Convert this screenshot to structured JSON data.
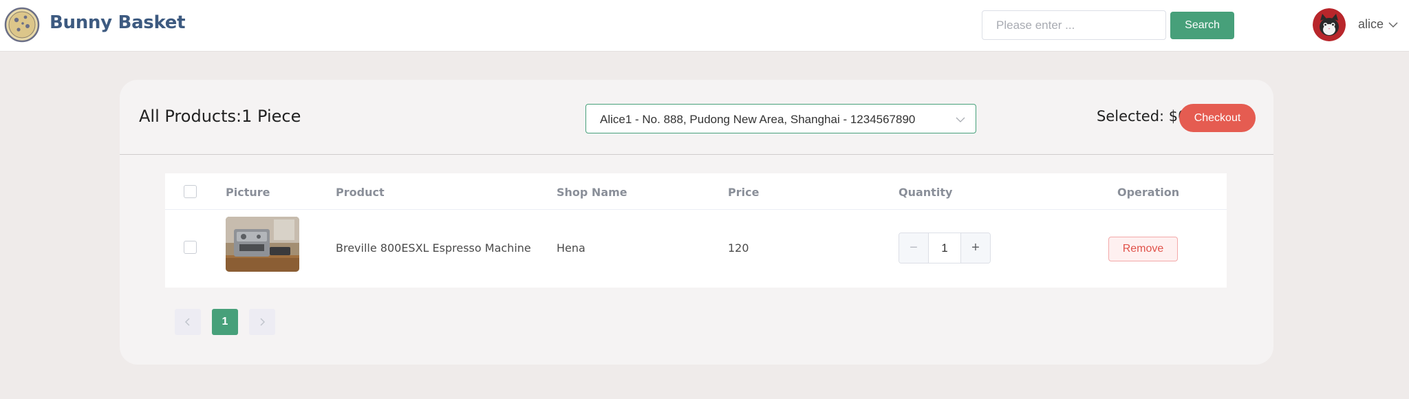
{
  "header": {
    "brand": "Bunny Basket",
    "search_placeholder": "Please enter ...",
    "search_button": "Search",
    "username": "alice"
  },
  "cart": {
    "all_products_label": "All Products:1 Piece",
    "address": "Alice1 - No. 888, Pudong New Area, Shanghai - 1234567890",
    "selected_label": "Selected: $0",
    "checkout_button": "Checkout",
    "columns": {
      "picture": "Picture",
      "product": "Product",
      "shop_name": "Shop Name",
      "price": "Price",
      "quantity": "Quantity",
      "operation": "Operation"
    },
    "rows": [
      {
        "product": "Breville 800ESXL Espresso Machine",
        "shop_name": "Hena",
        "price": "120",
        "quantity": "1",
        "remove_label": "Remove"
      }
    ]
  },
  "pagination": {
    "current_page": "1"
  },
  "colors": {
    "brand": "#3d5a80",
    "accent_green": "#47a07a",
    "checkout_red": "#e55c51"
  },
  "icons": {
    "logo": "cookie-logo-icon",
    "avatar": "cat-avatar-icon",
    "user_menu": "chevron-down-icon",
    "address_dropdown": "chevron-down-icon",
    "minus": "minus-icon",
    "plus": "plus-icon",
    "prev": "chevron-left-icon",
    "next": "chevron-right-icon"
  }
}
